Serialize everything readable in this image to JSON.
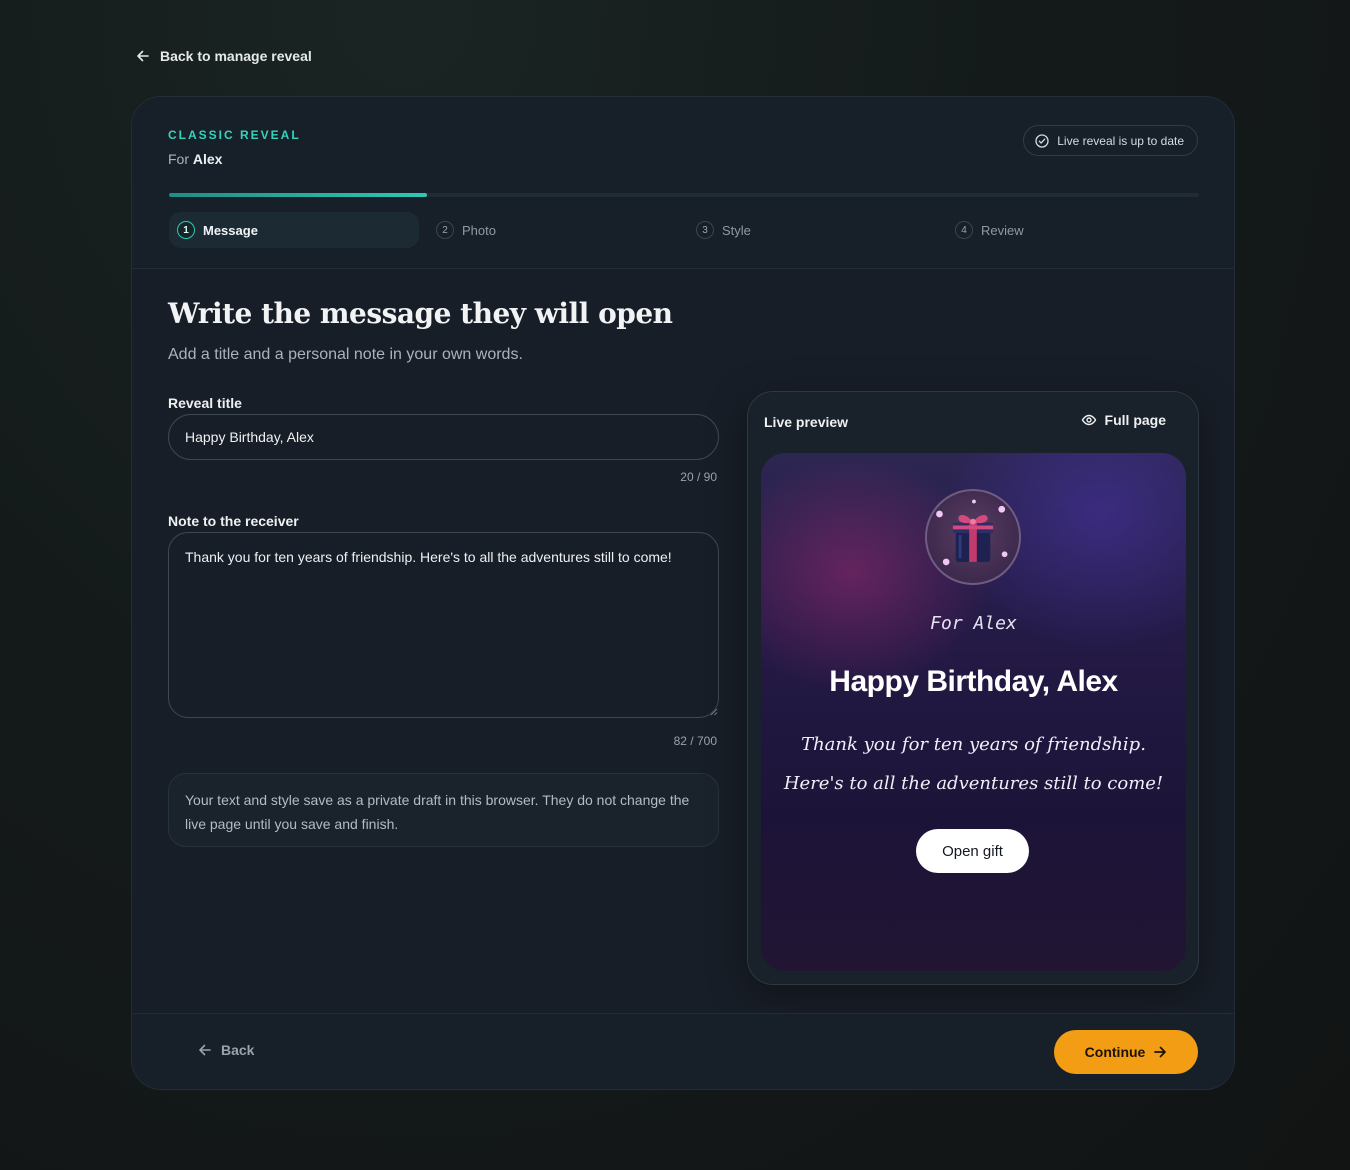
{
  "nav": {
    "back_link": "Back to manage reveal"
  },
  "header": {
    "eyebrow": "CLASSIC REVEAL",
    "for_prefix": "For",
    "recipient": "Alex",
    "status": "Live reveal is up to date",
    "progress": 0.25
  },
  "steps": [
    {
      "num": "1",
      "label": "Message",
      "active": true
    },
    {
      "num": "2",
      "label": "Photo",
      "active": false
    },
    {
      "num": "3",
      "label": "Style",
      "active": false
    },
    {
      "num": "4",
      "label": "Review",
      "active": false
    }
  ],
  "main": {
    "heading": "Write the message they will open",
    "subheading": "Add a title and a personal note in your own words."
  },
  "form": {
    "title_label": "Reveal title",
    "title_value": "Happy Birthday, Alex",
    "title_counter": "20 / 90",
    "note_label": "Note to the receiver",
    "note_value": "Thank you for ten years of friendship. Here's to all the adventures still to come!",
    "note_counter": "82 / 700",
    "info": "Your text and style save as a private draft in this browser. They do not change the live page until you save and finish."
  },
  "preview": {
    "label": "Live preview",
    "full_page": "Full page",
    "for_text": "For Alex",
    "title": "Happy Birthday, Alex",
    "note": "Thank you for ten years of friendship. Here's to all the adventures still to come!",
    "open_button": "Open gift"
  },
  "footer": {
    "back": "Back",
    "continue": "Continue"
  },
  "colors": {
    "accent": "#34d3bc",
    "cta": "#f29d14",
    "card": "#181e27"
  },
  "icons": {
    "back": "arrow-left-icon",
    "status": "check-circle-icon",
    "full_page": "eye-icon",
    "continue": "arrow-right-icon",
    "gift": "gift-icon"
  }
}
